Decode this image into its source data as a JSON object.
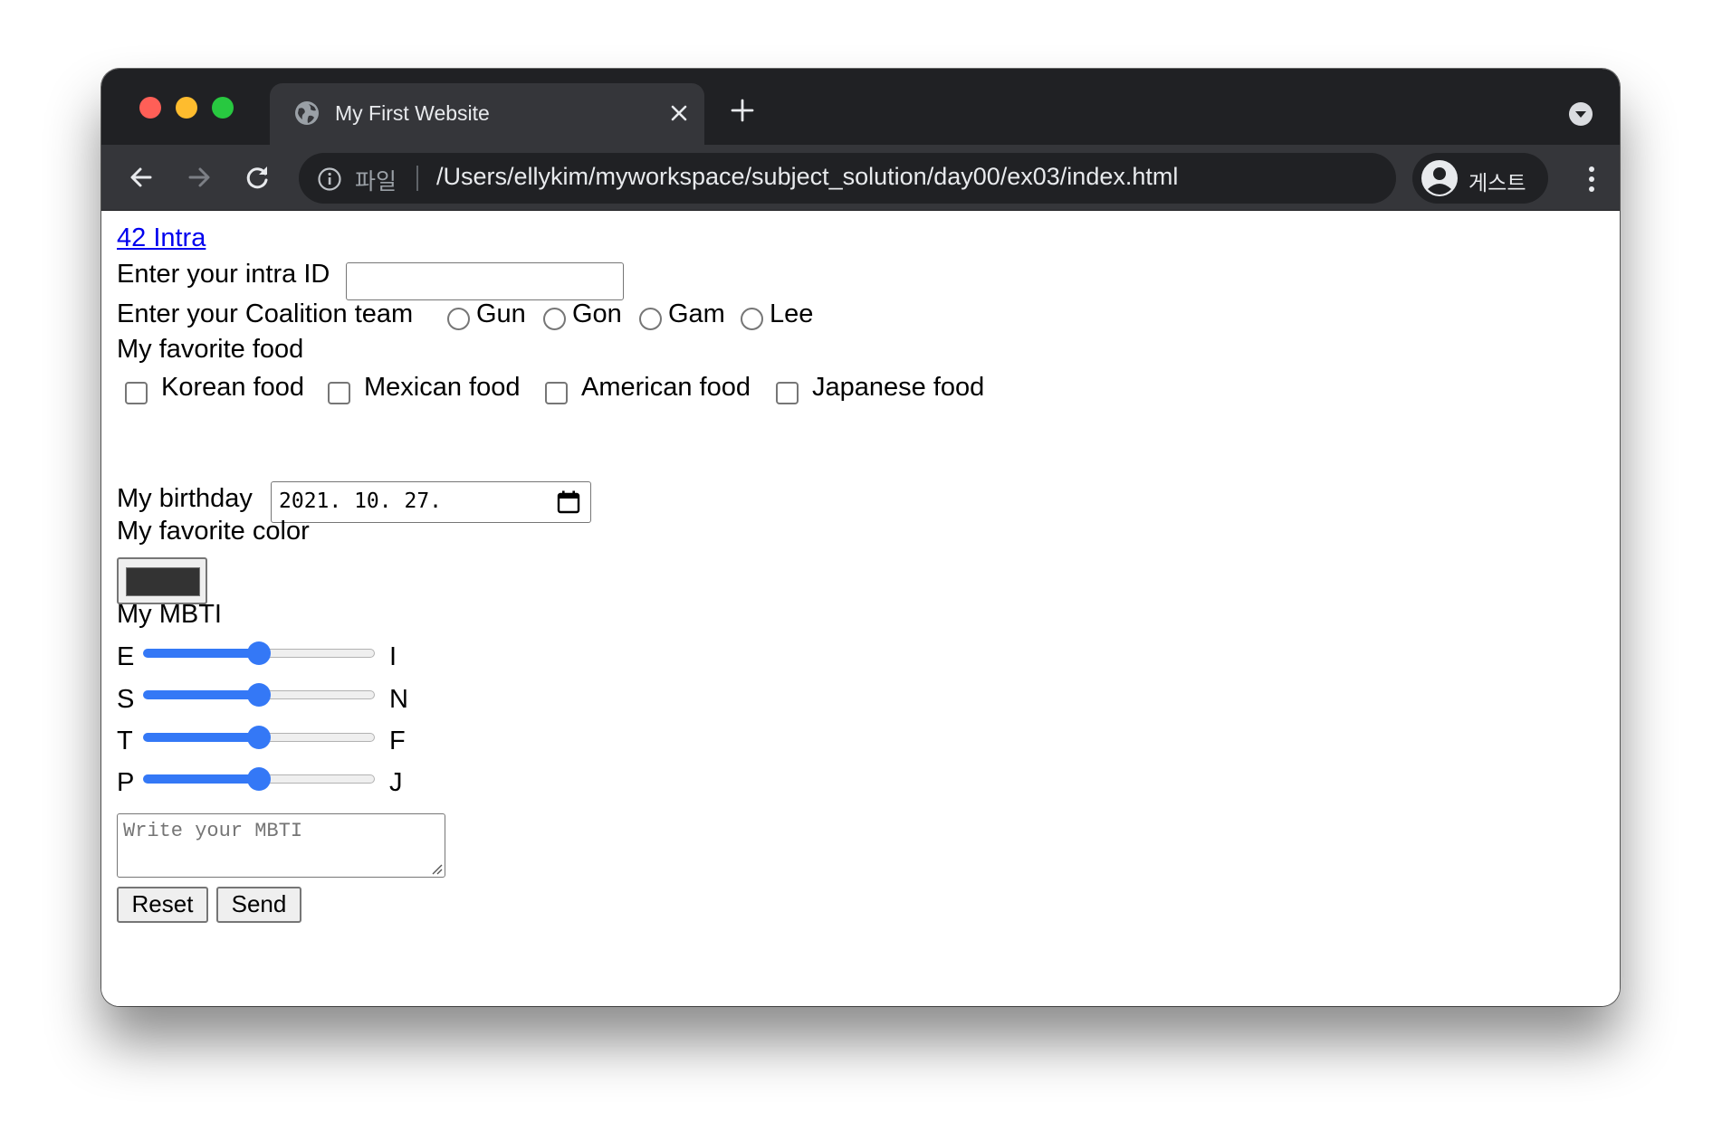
{
  "browser": {
    "tab": {
      "title": "My First Website"
    },
    "address": {
      "scheme_label": "파일",
      "url": "/Users/ellykim/myworkspace/subject_solution/day00/ex03/index.html"
    },
    "profile_label": "게스트"
  },
  "page": {
    "link": "42 Intra",
    "intra_label": "Enter your intra ID",
    "intra_value": "",
    "coalition_label": "Enter your Coalition team",
    "coalition_options": [
      "Gun",
      "Gon",
      "Gam",
      "Lee"
    ],
    "food_heading": "My favorite food",
    "food_options": [
      "Korean food",
      "Mexican food",
      "American food",
      "Japanese food"
    ],
    "birthday_label": "My birthday",
    "birthday_value": "2021. 10. 27.",
    "color_heading": "My favorite color",
    "color_value": "#333333",
    "mbti_heading": "My MBTI",
    "sliders": [
      {
        "left": "E",
        "right": "I",
        "value": 0.5
      },
      {
        "left": "S",
        "right": "N",
        "value": 0.5
      },
      {
        "left": "T",
        "right": "F",
        "value": 0.5
      },
      {
        "left": "P",
        "right": "J",
        "value": 0.5
      }
    ],
    "textarea_placeholder": "Write your MBTI",
    "reset_label": "Reset",
    "send_label": "Send"
  },
  "colors": {
    "tabstrip": "#202124",
    "toolbar": "#35363a",
    "link": "#0000ee",
    "slider_accent": "#3478f6"
  }
}
